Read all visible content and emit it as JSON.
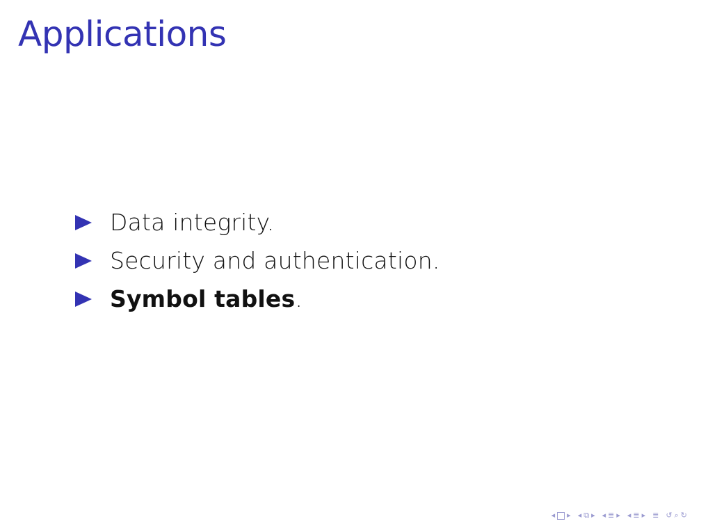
{
  "slide": {
    "title": "Applications",
    "bullets": [
      {
        "text": "Data integrity.",
        "bold_part": "",
        "suffix": ""
      },
      {
        "text": "Security and authentication.",
        "bold_part": "",
        "suffix": ""
      },
      {
        "text": "",
        "bold_part": "Symbol tables",
        "suffix": "."
      }
    ]
  },
  "navigation": {
    "icons": [
      "nav-prev-slide-icon",
      "nav-slide-icon",
      "nav-next-slide-icon",
      "nav-prev-frame-icon",
      "nav-frame-icon",
      "nav-next-frame-icon",
      "nav-prev-subsection-icon",
      "nav-subsection-icon",
      "nav-next-subsection-icon",
      "nav-prev-section-icon",
      "nav-section-icon",
      "nav-next-section-icon",
      "nav-document-icon",
      "nav-back-icon",
      "nav-search-icon",
      "nav-forward-icon"
    ]
  },
  "colors": {
    "accent": "#3333b3",
    "text": "#111111",
    "nav": "#9a9ad0"
  }
}
